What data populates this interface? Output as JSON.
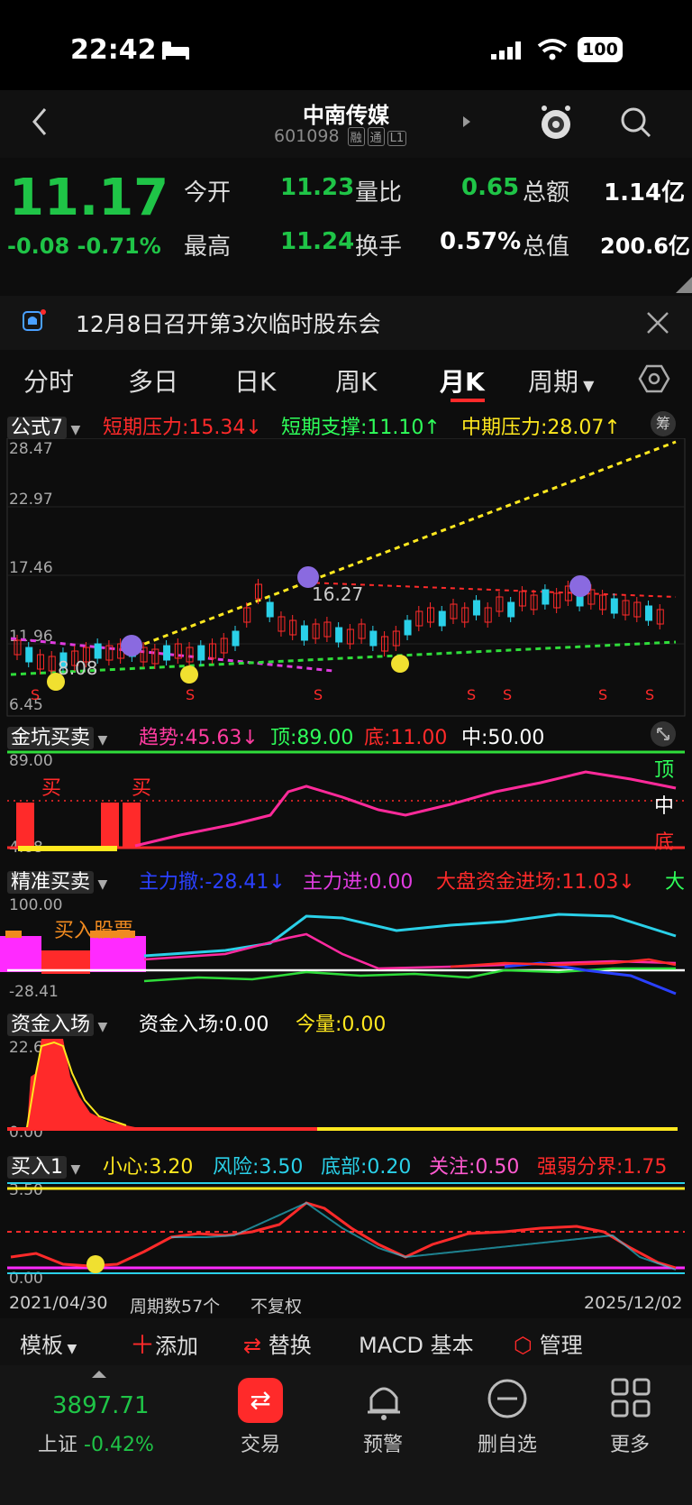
{
  "status_bar": {
    "time": "22:42",
    "battery": "100"
  },
  "header": {
    "title": "中南传媒",
    "code": "601098",
    "tags": [
      "融",
      "通",
      "L1"
    ]
  },
  "quote": {
    "price": "11.17",
    "change": "-0.08",
    "change_pct": "-0.71%",
    "open_label": "今开",
    "open": "11.23",
    "vol_ratio_label": "量比",
    "vol_ratio": "0.65",
    "amount_label": "总额",
    "amount": "1.14亿",
    "high_label": "最高",
    "high": "11.24",
    "turnover_label": "换手",
    "turnover": "0.57%",
    "mcap_label": "总值",
    "mcap": "200.6亿"
  },
  "notice": {
    "text": "12月8日召开第3次临时股东会"
  },
  "tabs": [
    "分时",
    "多日",
    "日K",
    "周K",
    "月K",
    "周期"
  ],
  "active_tab": "月K",
  "main_chart": {
    "formula": "公式7",
    "short_pressure": "短期压力:15.34↓",
    "short_support": "短期支撑:11.10↑",
    "mid_pressure": "中期压力:28.07↑",
    "chip_btn": "筹",
    "y_ticks": [
      "28.47",
      "22.97",
      "17.46",
      "11.96",
      "6.45"
    ],
    "high_mark": "16.27",
    "low_mark": "8.08",
    "low_axis": "6.45"
  },
  "pit_chart": {
    "name": "金坑买卖",
    "trend": "趋势:45.63↓",
    "top": "顶:89.00",
    "bottom": "底:11.00",
    "mid": "中:50.00",
    "y_top": "89.00",
    "y_bottom": "4.68",
    "buy": "买",
    "side_top": "顶",
    "side_mid": "中",
    "side_bottom": "底"
  },
  "precise_chart": {
    "name": "精准买卖",
    "main_withdraw": "主力撤:-28.41↓",
    "main_in": "主力进:0.00",
    "market_in": "大盘资金进场:11.03↓",
    "more": "大",
    "y_top": "100.00",
    "y_bottom": "-28.41",
    "buy_text": "买入股票"
  },
  "fund_chart": {
    "name": "资金入场",
    "fund_in": "资金入场:0.00",
    "today_label": "今量:",
    "today_val": "0.00",
    "y_top": "22.69",
    "y_bottom": "0.00"
  },
  "buy1_chart": {
    "name": "买入1",
    "careful": "小心:3.20",
    "risk": "风险:3.50",
    "bottom": "底部:0.20",
    "focus": "关注:0.50",
    "boundary": "强弱分界:1.75",
    "y_top": "3.50",
    "y_bottom": "0.00"
  },
  "range": {
    "start": "2021/04/30",
    "periods": "周期数57个",
    "adj": "不复权",
    "end": "2025/12/02"
  },
  "toolbar": {
    "template": "模板",
    "add": "添加",
    "replace": "替换",
    "macd": "MACD 基本",
    "manage": "管理"
  },
  "index": {
    "value": "3897.71",
    "name": "上证",
    "pct": "-0.42%"
  },
  "nav": [
    "交易",
    "预警",
    "删自选",
    "更多"
  ],
  "colors": {
    "up": "#ff2a2a",
    "down": "#1fc447",
    "cyan": "#2ad0e8",
    "yellow": "#f7e01f",
    "magenta": "#ff2aff"
  }
}
